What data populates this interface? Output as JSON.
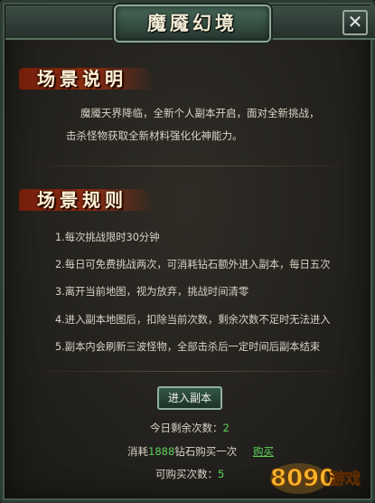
{
  "window": {
    "title": "魔魇幻境",
    "close_label": "✕"
  },
  "scene_intro": {
    "heading": "场景说明",
    "line1": "魔魇天界降临，全新个人副本开启，面对全新挑战，",
    "line2": "击杀怪物获取全新材料强化化神能力。"
  },
  "scene_rules": {
    "heading": "场景规则",
    "items": [
      "1.每次挑战限时30分钟",
      "2.每日可免费挑战两次，可消耗钻石额外进入副本，每日五次",
      "3.离开当前地图，视为放弃，挑战时间清零",
      "4.进入副本地图后，扣除当前次数，剩余次数不足时无法进入",
      "5.副本内会刷新三波怪物，全部击杀后一定时间后副本结束"
    ]
  },
  "actions": {
    "enter_label": "进入副本"
  },
  "status": {
    "remaining_label": "今日剩余次数：",
    "remaining_value": "2",
    "cost_prefix": "消耗",
    "cost_amount": "1888",
    "cost_suffix": "钻石购买一次",
    "buy_label": "购买",
    "purchasable_label": "可购买次数：",
    "purchasable_value": "5"
  },
  "watermark": {
    "number": "8090",
    "text": "游戏"
  },
  "colors": {
    "accent_green": "#5ed35b",
    "heading_red": "#a8320f"
  }
}
